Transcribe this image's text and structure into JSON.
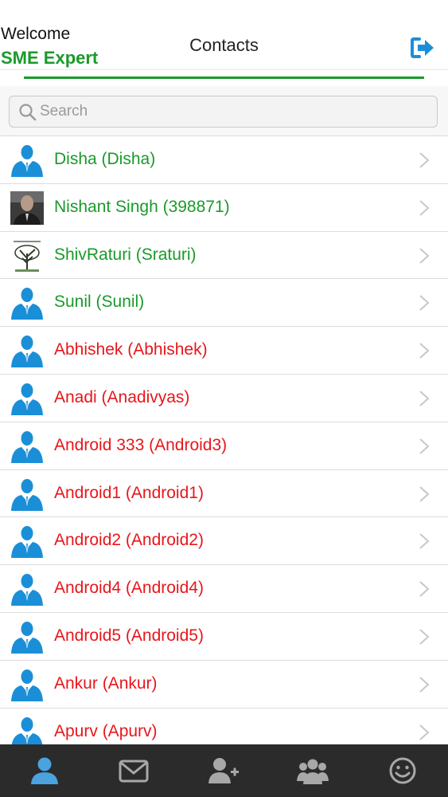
{
  "header": {
    "welcome": "Welcome",
    "username": "SME Expert",
    "title": "Contacts",
    "logout_icon": "sign-out-icon"
  },
  "search": {
    "placeholder": "Search"
  },
  "contacts": [
    {
      "label": "Disha (Disha)",
      "status": "online",
      "avatar": "default-user"
    },
    {
      "label": "Nishant Singh (398871)",
      "status": "online",
      "avatar": "photo-person"
    },
    {
      "label": "ShivRaturi (Sraturi)",
      "status": "online",
      "avatar": "photo-tree"
    },
    {
      "label": "Sunil (Sunil)",
      "status": "online",
      "avatar": "default-user"
    },
    {
      "label": "Abhishek (Abhishek)",
      "status": "offline",
      "avatar": "default-user"
    },
    {
      "label": "Anadi (Anadivyas)",
      "status": "offline",
      "avatar": "default-user"
    },
    {
      "label": "Android 333 (Android3)",
      "status": "offline",
      "avatar": "default-user"
    },
    {
      "label": "Android1 (Android1)",
      "status": "offline",
      "avatar": "default-user"
    },
    {
      "label": "Android2 (Android2)",
      "status": "offline",
      "avatar": "default-user"
    },
    {
      "label": "Android4 (Android4)",
      "status": "offline",
      "avatar": "default-user"
    },
    {
      "label": "Android5 (Android5)",
      "status": "offline",
      "avatar": "default-user"
    },
    {
      "label": "Ankur (Ankur)",
      "status": "offline",
      "avatar": "default-user"
    },
    {
      "label": "Apurv (Apurv)",
      "status": "offline",
      "avatar": "default-user"
    }
  ],
  "tabs": [
    {
      "icon": "contacts-icon",
      "active": true
    },
    {
      "icon": "mail-icon",
      "active": false
    },
    {
      "icon": "add-user-icon",
      "active": false
    },
    {
      "icon": "group-icon",
      "active": false
    },
    {
      "icon": "smiley-icon",
      "active": false
    }
  ],
  "colors": {
    "online": "#1a9a2a",
    "offline": "#e8161c",
    "accent": "#1a9a2a",
    "icon_blue": "#1a8fd8",
    "tab_active": "#4aa3df",
    "tab_inactive": "#a8a8a8",
    "tabbar_bg": "#2b2b2b"
  }
}
